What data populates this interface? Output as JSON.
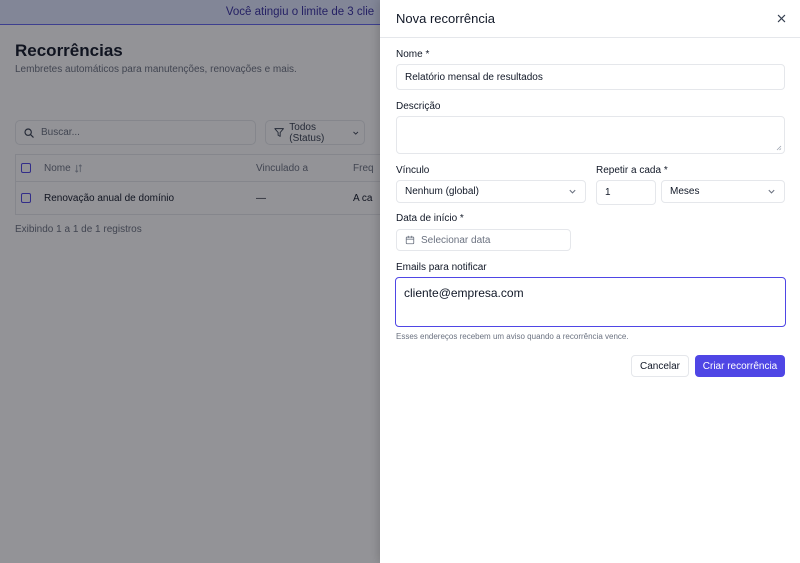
{
  "banner": {
    "text": "Você atingiu o limite de 3 clie"
  },
  "page": {
    "title": "Recorrências",
    "subtitle": "Lembretes automáticos para manutenções, renovações e mais.",
    "search_placeholder": "Buscar...",
    "filter_label": "Todos (Status)",
    "table": {
      "columns": [
        "Nome",
        "Vinculado a",
        "Freq"
      ],
      "rows": [
        {
          "name": "Renovação anual de domínio",
          "linked": "—",
          "freq": "A ca"
        }
      ]
    },
    "footer": "Exibindo 1 a 1 de 1 registros"
  },
  "drawer": {
    "title": "Nova recorrência",
    "name": {
      "label": "Nome *",
      "value": "Relatório mensal de resultados"
    },
    "description": {
      "label": "Descrição",
      "value": ""
    },
    "link": {
      "label": "Vínculo",
      "value": "Nenhum (global)"
    },
    "repeat": {
      "label": "Repetir a cada *",
      "value": "1",
      "unit": "Meses"
    },
    "start_date": {
      "label": "Data de início *",
      "placeholder": "Selecionar data"
    },
    "emails": {
      "label": "Emails para notificar",
      "value": "cliente@empresa.com",
      "hint": "Esses endereços recebem um aviso quando a recorrência vence."
    },
    "cancel_label": "Cancelar",
    "submit_label": "Criar recorrência"
  },
  "colors": {
    "accent": "#4f46e5",
    "banner_bg": "#e0e7ff",
    "banner_text": "#3730a3"
  }
}
